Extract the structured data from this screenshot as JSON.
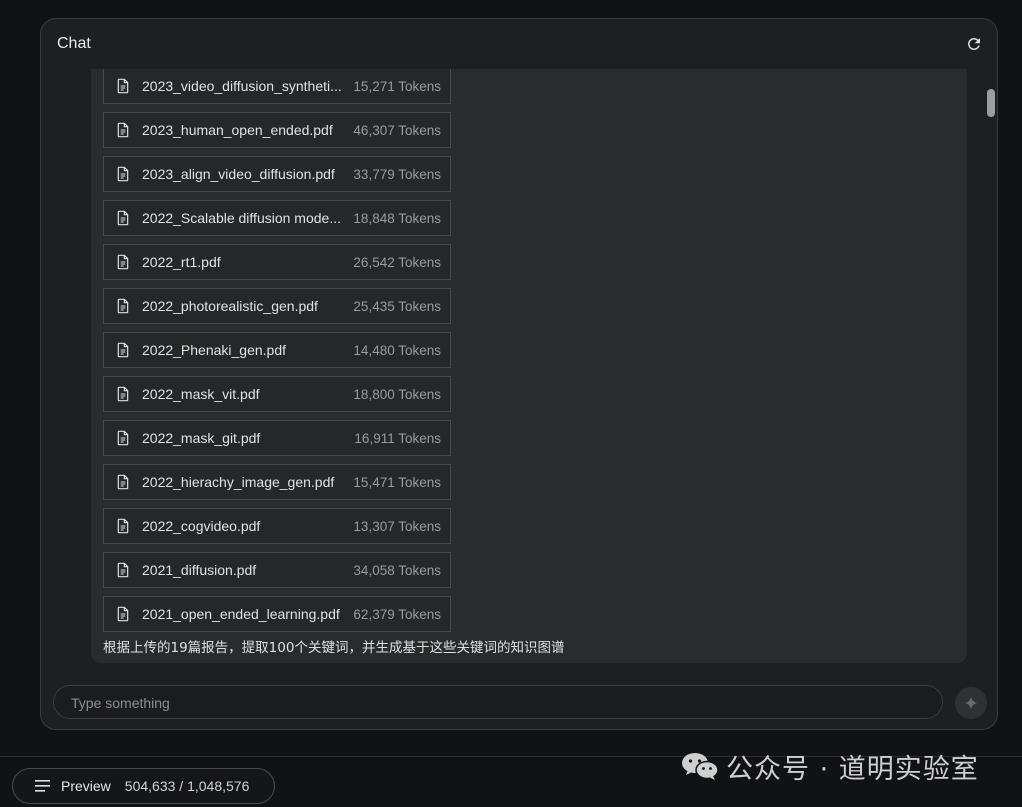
{
  "header": {
    "title": "Chat",
    "refresh_icon": "refresh-icon"
  },
  "files": [
    {
      "name": "2023_video_diffusion_syntheti...",
      "tokens": "15,271 Tokens"
    },
    {
      "name": "2023_human_open_ended.pdf",
      "tokens": "46,307 Tokens"
    },
    {
      "name": "2023_align_video_diffusion.pdf",
      "tokens": "33,779 Tokens"
    },
    {
      "name": "2022_Scalable diffusion mode...",
      "tokens": "18,848 Tokens"
    },
    {
      "name": "2022_rt1.pdf",
      "tokens": "26,542 Tokens"
    },
    {
      "name": "2022_photorealistic_gen.pdf",
      "tokens": "25,435 Tokens"
    },
    {
      "name": "2022_Phenaki_gen.pdf",
      "tokens": "14,480 Tokens"
    },
    {
      "name": "2022_mask_vit.pdf",
      "tokens": "18,800 Tokens"
    },
    {
      "name": "2022_mask_git.pdf",
      "tokens": "16,911 Tokens"
    },
    {
      "name": "2022_hierachy_image_gen.pdf",
      "tokens": "15,471 Tokens"
    },
    {
      "name": "2022_cogvideo.pdf",
      "tokens": "13,307 Tokens"
    },
    {
      "name": "2021_diffusion.pdf",
      "tokens": "34,058 Tokens"
    },
    {
      "name": "2021_open_ended_learning.pdf",
      "tokens": "62,379 Tokens"
    }
  ],
  "message": {
    "text": "根据上传的19篇报告，提取100个关键词，并生成基于这些关键词的知识图谱"
  },
  "input": {
    "placeholder": "Type something",
    "value": "",
    "send_icon": "sparkle-icon"
  },
  "footer": {
    "preview_label": "Preview",
    "token_count": "504,633 / 1,048,576",
    "menu_icon": "menu-icon"
  },
  "watermark": {
    "text": "公众号 · 道明实验室",
    "icon": "wechat-icon"
  },
  "colors": {
    "background": "#111214",
    "panel": "#1e1f21",
    "conversation": "#2a2b2d",
    "chip_border": "#48494c",
    "muted_text": "#9a9b9e"
  }
}
